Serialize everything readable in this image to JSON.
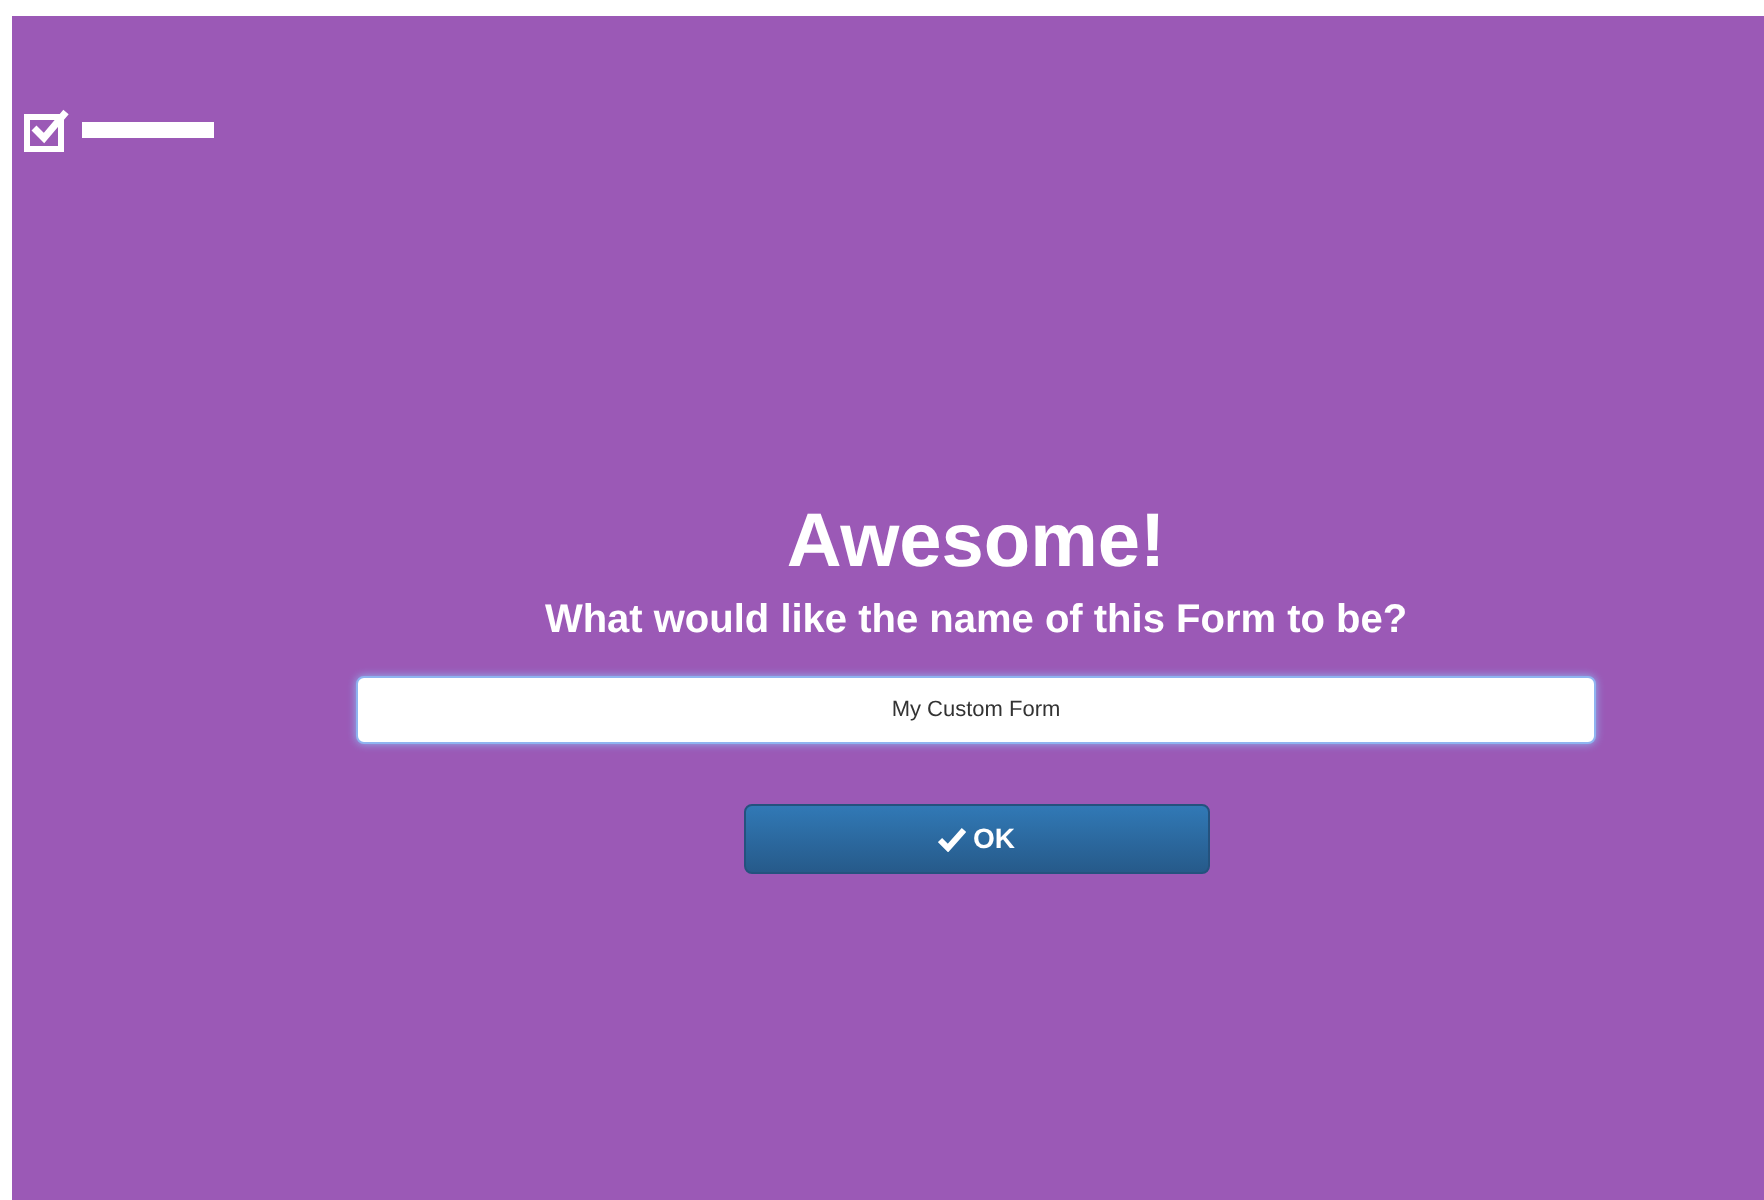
{
  "heading": "Awesome!",
  "question": "What would like the name of this Form to be?",
  "name_field": {
    "value": "My Custom Form"
  },
  "ok_button": {
    "label": "OK"
  }
}
